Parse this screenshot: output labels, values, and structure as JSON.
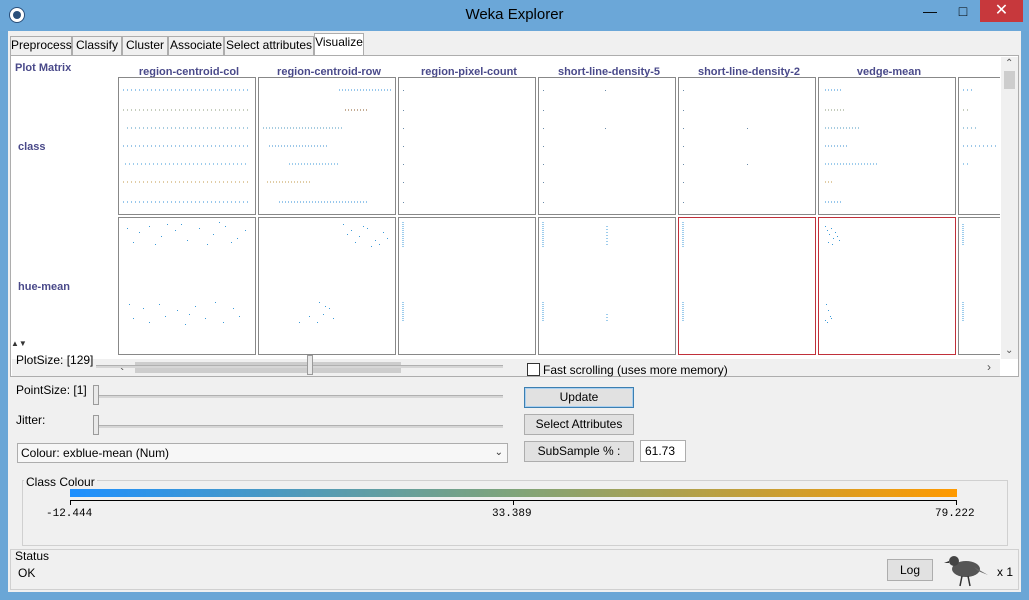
{
  "window": {
    "title": "Weka Explorer",
    "min": "—",
    "max": "□",
    "close": "✕"
  },
  "tabs": [
    {
      "label": "Preprocess"
    },
    {
      "label": "Classify"
    },
    {
      "label": "Cluster"
    },
    {
      "label": "Associate"
    },
    {
      "label": "Select attributes"
    },
    {
      "label": "Visualize"
    }
  ],
  "active_tab": "Visualize",
  "matrix": {
    "title": "Plot Matrix",
    "columns": [
      "region-centroid-col",
      "region-centroid-row",
      "region-pixel-count",
      "short-line-density-5",
      "short-line-density-2",
      "vedge-mean"
    ],
    "rows": [
      "class",
      "hue-mean"
    ]
  },
  "controls": {
    "plotsize_label": "PlotSize: [129]",
    "pointsize_label": "PointSize: [1]",
    "jitter_label": "Jitter:",
    "colour_select": "Colour: exblue-mean  (Num)",
    "fast_scrolling": "Fast scrolling (uses more memory)",
    "update_button": "Update",
    "select_attributes_button": "Select Attributes",
    "subsample_button": "SubSample % :",
    "subsample_value": "61.73"
  },
  "class_colour": {
    "title": "Class Colour",
    "min": "-12.444",
    "mid": "33.389",
    "max": "79.222",
    "gradient": [
      "#1e90ff",
      "#7fa47a",
      "#ff9a00"
    ]
  },
  "status": {
    "title": "Status",
    "text": "OK",
    "log_button": "Log",
    "count": "x 1"
  }
}
